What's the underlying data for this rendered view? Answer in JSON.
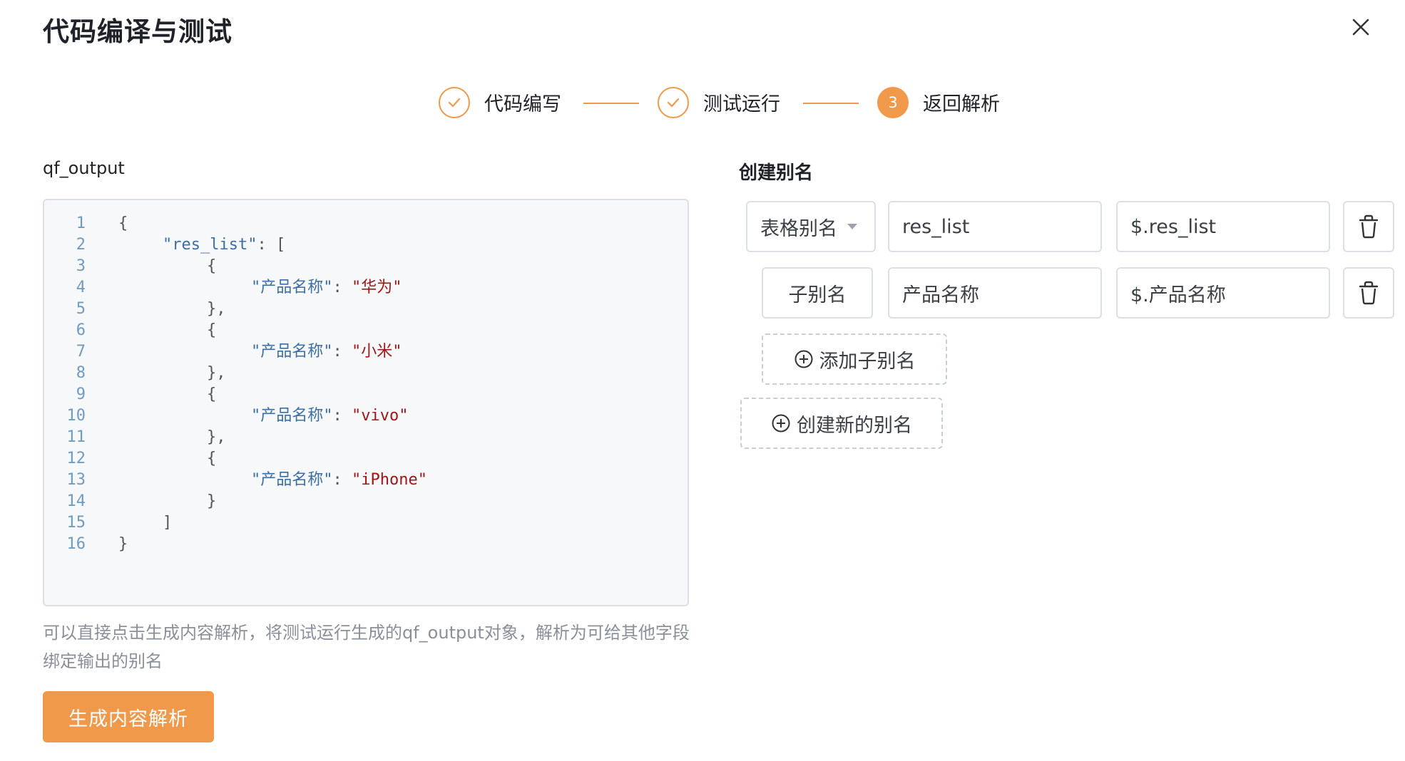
{
  "dialog": {
    "title": "代码编译与测试"
  },
  "steps": [
    {
      "label": "代码编写",
      "status": "done"
    },
    {
      "label": "测试运行",
      "status": "done"
    },
    {
      "label": "返回解析",
      "status": "active",
      "number": "3"
    }
  ],
  "code_panel": {
    "title": "qf_output",
    "lines": [
      {
        "n": "1",
        "indent": 0,
        "parts": [
          {
            "t": "p",
            "v": "{"
          }
        ]
      },
      {
        "n": "2",
        "indent": 1,
        "parts": [
          {
            "t": "k",
            "v": "\"res_list\""
          },
          {
            "t": "p",
            "v": ": ["
          }
        ]
      },
      {
        "n": "3",
        "indent": 2,
        "parts": [
          {
            "t": "p",
            "v": "{"
          }
        ]
      },
      {
        "n": "4",
        "indent": 3,
        "parts": [
          {
            "t": "k",
            "v": "\"产品名称\""
          },
          {
            "t": "p",
            "v": ": "
          },
          {
            "t": "s",
            "v": "\"华为\""
          }
        ]
      },
      {
        "n": "5",
        "indent": 2,
        "parts": [
          {
            "t": "p",
            "v": "},"
          }
        ]
      },
      {
        "n": "6",
        "indent": 2,
        "parts": [
          {
            "t": "p",
            "v": "{"
          }
        ]
      },
      {
        "n": "7",
        "indent": 3,
        "parts": [
          {
            "t": "k",
            "v": "\"产品名称\""
          },
          {
            "t": "p",
            "v": ": "
          },
          {
            "t": "s",
            "v": "\"小米\""
          }
        ]
      },
      {
        "n": "8",
        "indent": 2,
        "parts": [
          {
            "t": "p",
            "v": "},"
          }
        ]
      },
      {
        "n": "9",
        "indent": 2,
        "parts": [
          {
            "t": "p",
            "v": "{"
          }
        ]
      },
      {
        "n": "10",
        "indent": 3,
        "parts": [
          {
            "t": "k",
            "v": "\"产品名称\""
          },
          {
            "t": "p",
            "v": ": "
          },
          {
            "t": "s",
            "v": "\"vivo\""
          }
        ]
      },
      {
        "n": "11",
        "indent": 2,
        "parts": [
          {
            "t": "p",
            "v": "},"
          }
        ]
      },
      {
        "n": "12",
        "indent": 2,
        "parts": [
          {
            "t": "p",
            "v": "{"
          }
        ]
      },
      {
        "n": "13",
        "indent": 3,
        "parts": [
          {
            "t": "k",
            "v": "\"产品名称\""
          },
          {
            "t": "p",
            "v": ": "
          },
          {
            "t": "s",
            "v": "\"iPhone\""
          }
        ]
      },
      {
        "n": "14",
        "indent": 2,
        "parts": [
          {
            "t": "p",
            "v": "}"
          }
        ]
      },
      {
        "n": "15",
        "indent": 1,
        "parts": [
          {
            "t": "p",
            "v": "]"
          }
        ]
      },
      {
        "n": "16",
        "indent": 0,
        "parts": [
          {
            "t": "p",
            "v": "}"
          }
        ]
      }
    ],
    "help_text": "可以直接点击生成内容解析，将测试运行生成的qf_output对象，解析为可给其他字段绑定输出的别名",
    "generate_button": "生成内容解析"
  },
  "alias_panel": {
    "title": "创建别名",
    "rows": [
      {
        "type_label": "表格别名",
        "has_dropdown": true,
        "name": "res_list",
        "path": "$.res_list"
      },
      {
        "type_label": "子别名",
        "has_dropdown": false,
        "name": "产品名称",
        "path": "$.产品名称"
      }
    ],
    "add_child_button": "添加子别名",
    "create_new_button": "创建新的别名"
  },
  "colors": {
    "accent": "#f0994a",
    "border": "#dcdfe6",
    "help_text": "#8a8f99"
  }
}
